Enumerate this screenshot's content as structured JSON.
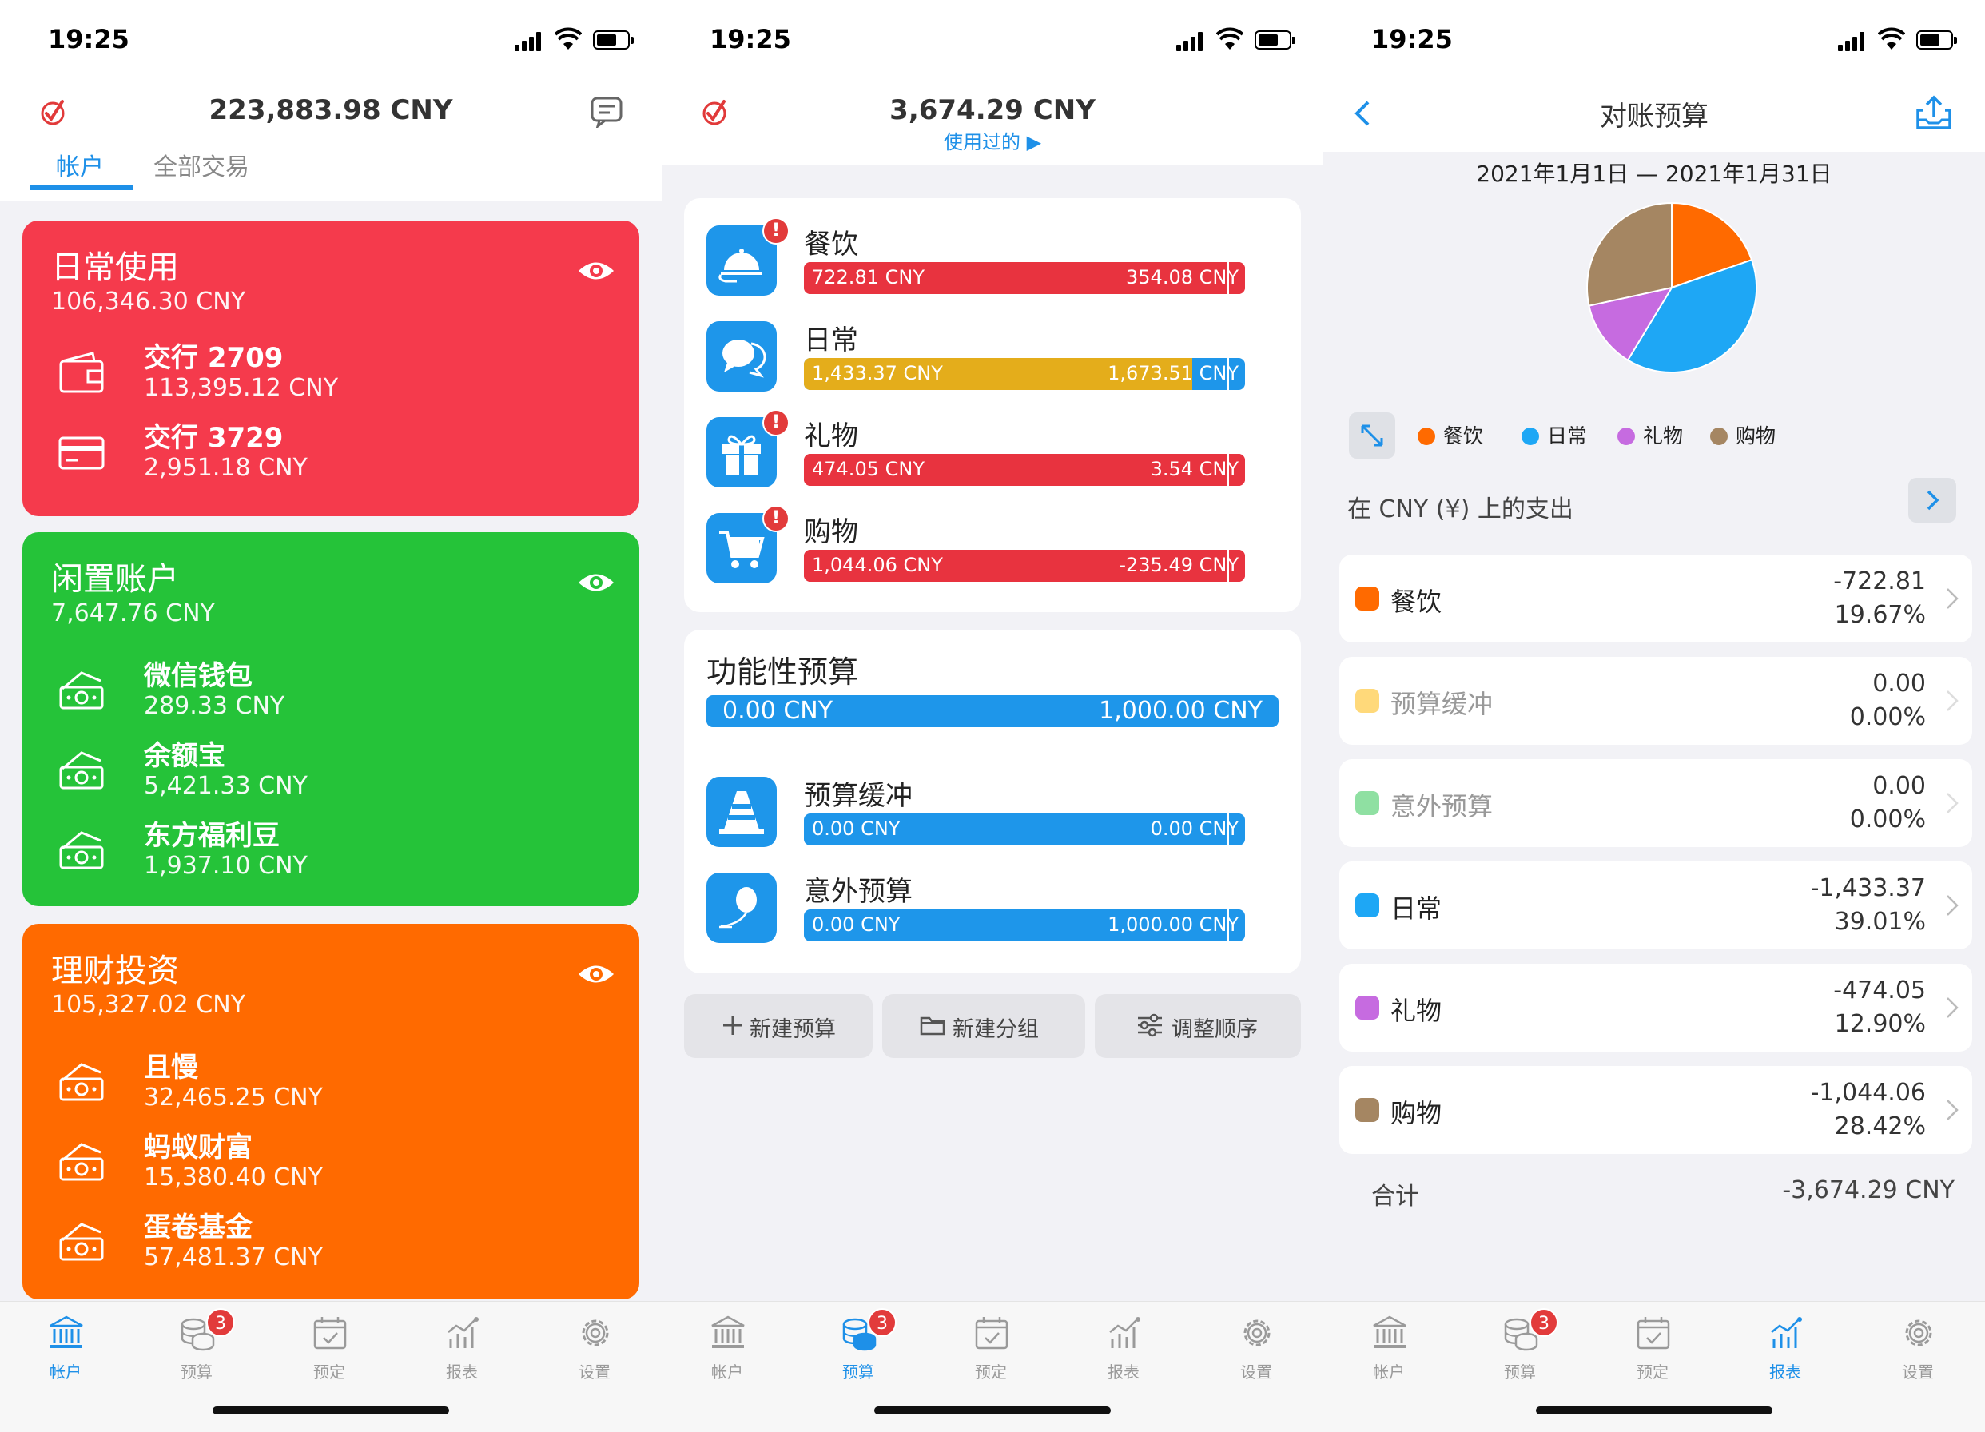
{
  "status": {
    "time": "19:25"
  },
  "screen1": {
    "header_total": "223,883.98 CNY",
    "tabs": [
      {
        "label": "帐户",
        "active": true
      },
      {
        "label": "全部交易",
        "active": false
      }
    ],
    "groups": [
      {
        "name": "日常使用",
        "total": "106,346.30 CNY",
        "color": "#f53a4c",
        "accounts": [
          {
            "name": "交行 2709",
            "balance": "113,395.12 CNY",
            "icon": "wallet-icon"
          },
          {
            "name": "交行 3729",
            "balance": "2,951.18 CNY",
            "icon": "credit-card-icon"
          }
        ]
      },
      {
        "name": "闲置账户",
        "total": "7,647.76 CNY",
        "color": "#25c339",
        "accounts": [
          {
            "name": "微信钱包",
            "balance": "289.33 CNY",
            "icon": "cash-stack-icon"
          },
          {
            "name": "余额宝",
            "balance": "5,421.33 CNY",
            "icon": "cash-stack-icon"
          },
          {
            "name": "东方福利豆",
            "balance": "1,937.10 CNY",
            "icon": "cash-stack-icon"
          }
        ]
      },
      {
        "name": "理财投资",
        "total": "105,327.02 CNY",
        "color": "#ff6a00",
        "accounts": [
          {
            "name": "且慢",
            "balance": "32,465.25 CNY",
            "icon": "cash-stack-icon"
          },
          {
            "name": "蚂蚁财富",
            "balance": "15,380.40 CNY",
            "icon": "cash-stack-icon"
          },
          {
            "name": "蛋卷基金",
            "balance": "57,481.37 CNY",
            "icon": "cash-stack-icon"
          }
        ]
      }
    ]
  },
  "screen2": {
    "header_total": "3,674.29 CNY",
    "header_sub": "使用过的 ▶",
    "budgets": [
      {
        "name": "餐饮",
        "used": "722.81 CNY",
        "remaining": "354.08 CNY",
        "warning": "!",
        "icon": "food-cloche-icon"
      },
      {
        "name": "日常",
        "used": "1,433.37 CNY",
        "remaining": "1,673.51 CNY",
        "warning": "",
        "icon": "chat-bubbles-icon"
      },
      {
        "name": "礼物",
        "used": "474.05 CNY",
        "remaining": "3.54 CNY",
        "warning": "!",
        "icon": "gift-icon"
      },
      {
        "name": "购物",
        "used": "1,044.06 CNY",
        "remaining": "-235.49 CNY",
        "warning": "!",
        "icon": "shopping-cart-icon"
      }
    ],
    "functional": {
      "title": "功能性预算",
      "used": "0.00 CNY",
      "total": "1,000.00 CNY",
      "items": [
        {
          "name": "预算缓冲",
          "used": "0.00 CNY",
          "remaining": "0.00 CNY",
          "icon": "traffic-cone-icon"
        },
        {
          "name": "意外预算",
          "used": "0.00 CNY",
          "remaining": "1,000.00 CNY",
          "icon": "balloon-icon"
        }
      ]
    },
    "actions": [
      {
        "label": "新建预算",
        "icon": "plus-icon"
      },
      {
        "label": "新建分组",
        "icon": "folder-icon"
      },
      {
        "label": "调整顺序",
        "icon": "sliders-icon"
      }
    ]
  },
  "screen3": {
    "title": "对账预算",
    "date_range": "2021年1月1日 — 2021年1月31日",
    "legend": [
      {
        "label": "餐饮",
        "color": "#ff6a00"
      },
      {
        "label": "日常",
        "color": "#1ea7f5"
      },
      {
        "label": "礼物",
        "color": "#c66be0"
      },
      {
        "label": "购物",
        "color": "#a58662"
      }
    ],
    "spend_title": "在 CNY (¥) 上的支出",
    "rows": [
      {
        "name": "餐饮",
        "value": "-722.81",
        "pct": "19.67%",
        "color": "#ff6a00",
        "dim": false
      },
      {
        "name": "预算缓冲",
        "value": "0.00",
        "pct": "0.00%",
        "color": "#ffd97a",
        "dim": true
      },
      {
        "name": "意外预算",
        "value": "0.00",
        "pct": "0.00%",
        "color": "#8fe0a2",
        "dim": true
      },
      {
        "name": "日常",
        "value": "-1,433.37",
        "pct": "39.01%",
        "color": "#1ea7f5",
        "dim": false
      },
      {
        "name": "礼物",
        "value": "-474.05",
        "pct": "12.90%",
        "color": "#c66be0",
        "dim": false
      },
      {
        "name": "购物",
        "value": "-1,044.06",
        "pct": "28.42%",
        "color": "#a58662",
        "dim": false
      }
    ],
    "total_label": "合计",
    "total_value": "-3,674.29 CNY",
    "chart_data": {
      "type": "pie",
      "categories": [
        "餐饮",
        "日常",
        "礼物",
        "购物"
      ],
      "values": [
        19.67,
        39.01,
        12.9,
        28.42
      ],
      "colors": [
        "#ff6a00",
        "#1ea7f5",
        "#c66be0",
        "#a58662"
      ]
    }
  },
  "tabbar": {
    "items": [
      {
        "label": "帐户",
        "icon": "bank-icon"
      },
      {
        "label": "预算",
        "icon": "coins-icon",
        "badge": "3"
      },
      {
        "label": "预定",
        "icon": "calendar-check-icon"
      },
      {
        "label": "报表",
        "icon": "chart-icon"
      },
      {
        "label": "设置",
        "icon": "gear-icon"
      }
    ]
  }
}
